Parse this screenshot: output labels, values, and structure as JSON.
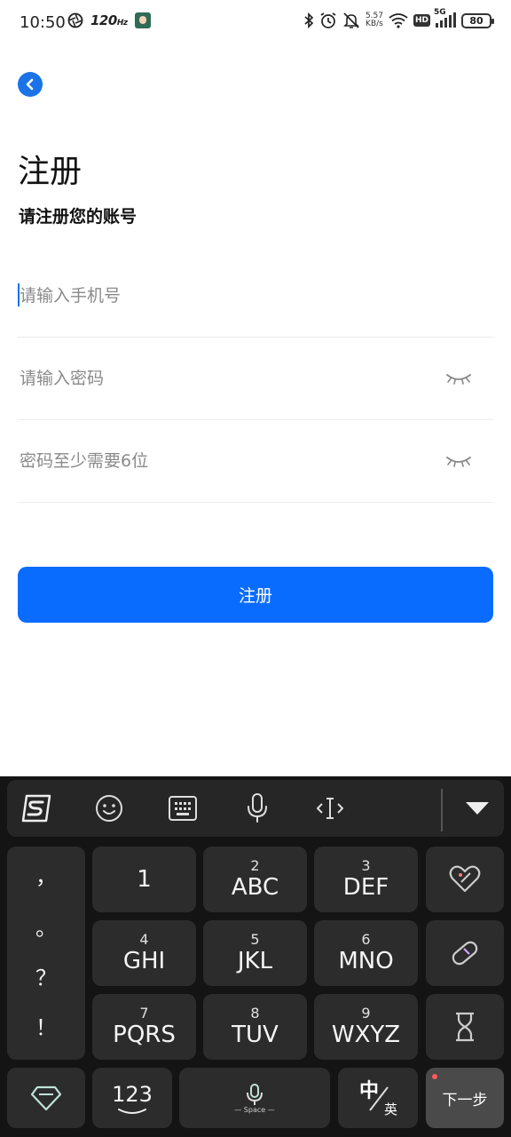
{
  "status_bar": {
    "time": "10:50",
    "refresh_rate": "120",
    "refresh_unit": "Hz",
    "net_speed_value": "5.57",
    "net_speed_unit": "KB/s",
    "hd_label": "HD",
    "network_label": "5G",
    "battery": "80"
  },
  "page": {
    "title": "注册",
    "subtitle": "请注册您的账号"
  },
  "form": {
    "phone_placeholder": "请输入手机号",
    "password_placeholder": "请输入密码",
    "confirm_placeholder": "密码至少需要6位",
    "submit_label": "注册"
  },
  "keyboard": {
    "punctuation": [
      "，",
      "。",
      "？",
      "！"
    ],
    "keys": [
      {
        "digit": "",
        "letters": "1"
      },
      {
        "digit": "2",
        "letters": "ABC"
      },
      {
        "digit": "3",
        "letters": "DEF"
      },
      {
        "digit": "4",
        "letters": "GHI"
      },
      {
        "digit": "5",
        "letters": "JKL"
      },
      {
        "digit": "6",
        "letters": "MNO"
      },
      {
        "digit": "7",
        "letters": "PQRS"
      },
      {
        "digit": "8",
        "letters": "TUV"
      },
      {
        "digit": "9",
        "letters": "WXYZ"
      }
    ],
    "num_label": "123",
    "space_label": "Space",
    "lang_zh": "中",
    "lang_en": "英",
    "next_label": "下一步"
  },
  "colors": {
    "accent": "#0a6cff",
    "back_button": "#1a73e8",
    "keyboard_bg": "#141414",
    "key_bg": "#2c2c2c"
  }
}
